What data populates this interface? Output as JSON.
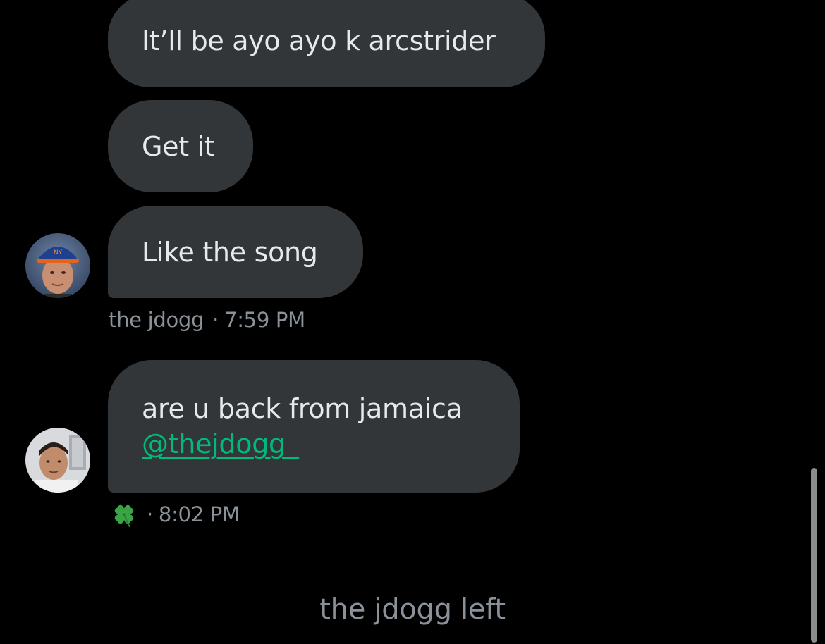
{
  "messages": [
    {
      "text": "It’ll be ayo ayo k arcstrider"
    },
    {
      "text": "Get it"
    },
    {
      "text": "Like the song"
    },
    {
      "text": "are u back from jamaica",
      "mention": "@thejdogg_"
    }
  ],
  "meta": [
    {
      "sender": "the jdogg",
      "separator": "·",
      "time": "7:59 PM"
    },
    {
      "sender_icon": "four-leaf-clover-icon",
      "separator": "·",
      "time": "8:02 PM"
    }
  ],
  "system_notice": "the jdogg left",
  "colors": {
    "background": "#000000",
    "bubble": "#333639",
    "text": "#e7e9ea",
    "muted": "#8b9198",
    "mention": "#00ba7c"
  }
}
